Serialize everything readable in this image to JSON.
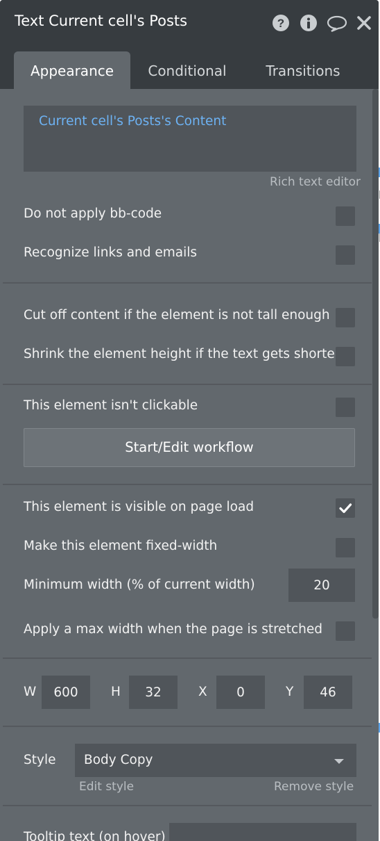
{
  "window": {
    "title": "Text Current cell's Posts",
    "icons": [
      "help-icon",
      "info-icon",
      "comment-icon",
      "close-icon"
    ]
  },
  "tabs": [
    {
      "label": "Appearance",
      "active": true
    },
    {
      "label": "Conditional",
      "active": false
    },
    {
      "label": "Transitions",
      "active": false
    }
  ],
  "content": {
    "value": "Current cell's Posts's Content",
    "editor_link": "Rich text editor"
  },
  "options": {
    "bbcode": {
      "label": "Do not apply bb-code",
      "checked": false
    },
    "links": {
      "label": "Recognize links and emails",
      "checked": false
    },
    "cutoff": {
      "label": "Cut off content if the element is not tall enough",
      "checked": false
    },
    "shrink": {
      "label": "Shrink the element height if the text gets shorter",
      "checked": false
    },
    "not_clickable": {
      "label": "This element isn't clickable",
      "checked": false
    },
    "visible": {
      "label": "This element is visible on page load",
      "checked": true
    },
    "fixed_width": {
      "label": "Make this element fixed-width",
      "checked": false
    },
    "max_width": {
      "label": "Apply a max width when the page is stretched",
      "checked": false
    }
  },
  "workflow_button": "Start/Edit workflow",
  "min_width": {
    "label": "Minimum width (% of current width)",
    "value": "20"
  },
  "dimensions": {
    "w": {
      "label": "W",
      "value": "600"
    },
    "h": {
      "label": "H",
      "value": "32"
    },
    "x": {
      "label": "X",
      "value": "0"
    },
    "y": {
      "label": "Y",
      "value": "46"
    }
  },
  "style": {
    "label": "Style",
    "selected": "Body Copy",
    "edit_link": "Edit style",
    "remove_link": "Remove style"
  },
  "tooltip": {
    "label": "Tooltip text (on hover)",
    "value": ""
  },
  "colors": {
    "panel_bg": "#62686d",
    "header_bg": "#373c40",
    "input_bg": "#50555a",
    "link": "#6db2f3"
  }
}
